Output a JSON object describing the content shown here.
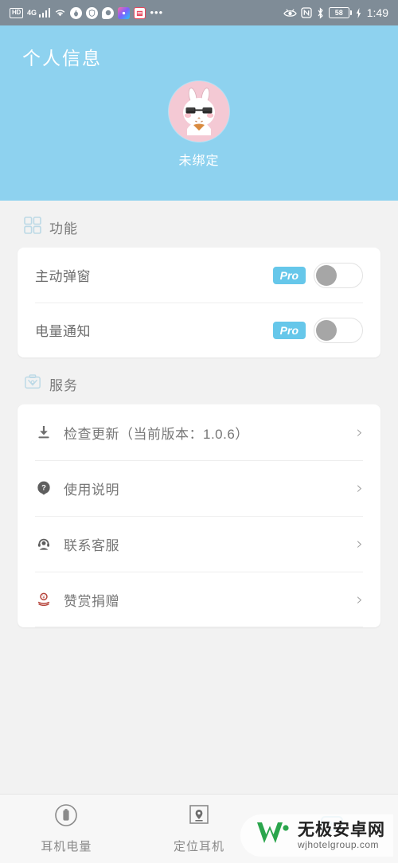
{
  "statusbar": {
    "hd_label": "HD",
    "network_label": "4G",
    "icons_left": [
      "hd-icon",
      "4g-icon",
      "signal-bars-icon",
      "wifi-icon",
      "fire-app-icon",
      "shield-app-icon",
      "message-app-icon",
      "photos-app-icon",
      "calendar-app-icon",
      "overflow-dots-icon"
    ],
    "overflow": "•••",
    "icons_right": [
      "eye-care-icon",
      "nfc-icon",
      "bluetooth-icon"
    ],
    "nfc_label": "N",
    "battery_level": "58",
    "charging": "⚡",
    "time": "1:49"
  },
  "header": {
    "title": "个人信息",
    "avatar_name": "rabbit-sunglasses-avatar",
    "bind_state": "未绑定"
  },
  "sections": {
    "functions": {
      "icon": "grid-icon",
      "label": "功能",
      "rows": [
        {
          "label": "主动弹窗",
          "badge": "Pro",
          "toggle_on": false
        },
        {
          "label": "电量通知",
          "badge": "Pro",
          "toggle_on": false
        }
      ]
    },
    "services": {
      "icon": "service-badge-icon",
      "label": "服务",
      "rows": [
        {
          "icon": "download-icon",
          "label": "检查更新（当前版本：1.0.6）",
          "chevron": "›"
        },
        {
          "icon": "question-mark-icon",
          "label": "使用说明",
          "chevron": "›"
        },
        {
          "icon": "customer-service-icon",
          "label": "联系客服",
          "chevron": "›"
        },
        {
          "icon": "donate-hand-coin-icon",
          "label": "赞赏捐赠",
          "chevron": "›"
        }
      ]
    }
  },
  "bottom_nav": [
    {
      "icon": "battery-circle-icon",
      "label": "耳机电量",
      "active": false
    },
    {
      "icon": "location-pin-icon",
      "label": "定位耳机",
      "active": false
    },
    {
      "icon": "earbuds-case-icon",
      "label": "",
      "active": true
    }
  ],
  "watermark": {
    "logo": "w-logo-icon",
    "cn": "无极安卓网",
    "en": "wjhotelgroup.com"
  },
  "colors": {
    "header_blue": "#8ed2ef",
    "statusbar_gray": "#7f8c97",
    "pro_badge": "#66c7ea",
    "page_bg": "#f2f2f2",
    "watermark_green": "#2aa54c"
  }
}
